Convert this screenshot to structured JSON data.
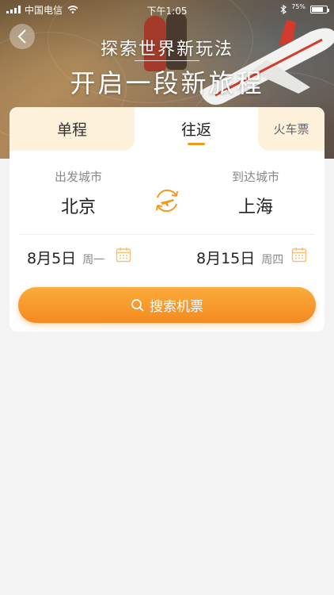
{
  "status_bar": {
    "carrier": "中国电信",
    "time": "下午1:05",
    "battery_percent": "75%",
    "battery_level": 0.75
  },
  "hero": {
    "subtitle": "探索世界新玩法",
    "title": "开启一段新旅程"
  },
  "tabs": [
    {
      "label": "单程",
      "active": false
    },
    {
      "label": "往返",
      "active": true
    },
    {
      "label": "火车票",
      "active": false
    }
  ],
  "route": {
    "from_label": "出发城市",
    "from_city": "北京",
    "to_label": "到达城市",
    "to_city": "上海"
  },
  "dates": {
    "depart_date": "8月5日",
    "depart_weekday": "周一",
    "return_date": "8月15日",
    "return_weekday": "周四"
  },
  "search": {
    "label": "搜索机票"
  },
  "icons": {
    "back": "chevron-left-icon",
    "swap": "plane-swap-icon",
    "calendar": "calendar-icon",
    "search": "search-icon"
  },
  "colors": {
    "accent": "#f39a1e",
    "tab_bg": "#fdf1dc",
    "button_start": "#fbab3c",
    "button_end": "#f48a1f"
  }
}
